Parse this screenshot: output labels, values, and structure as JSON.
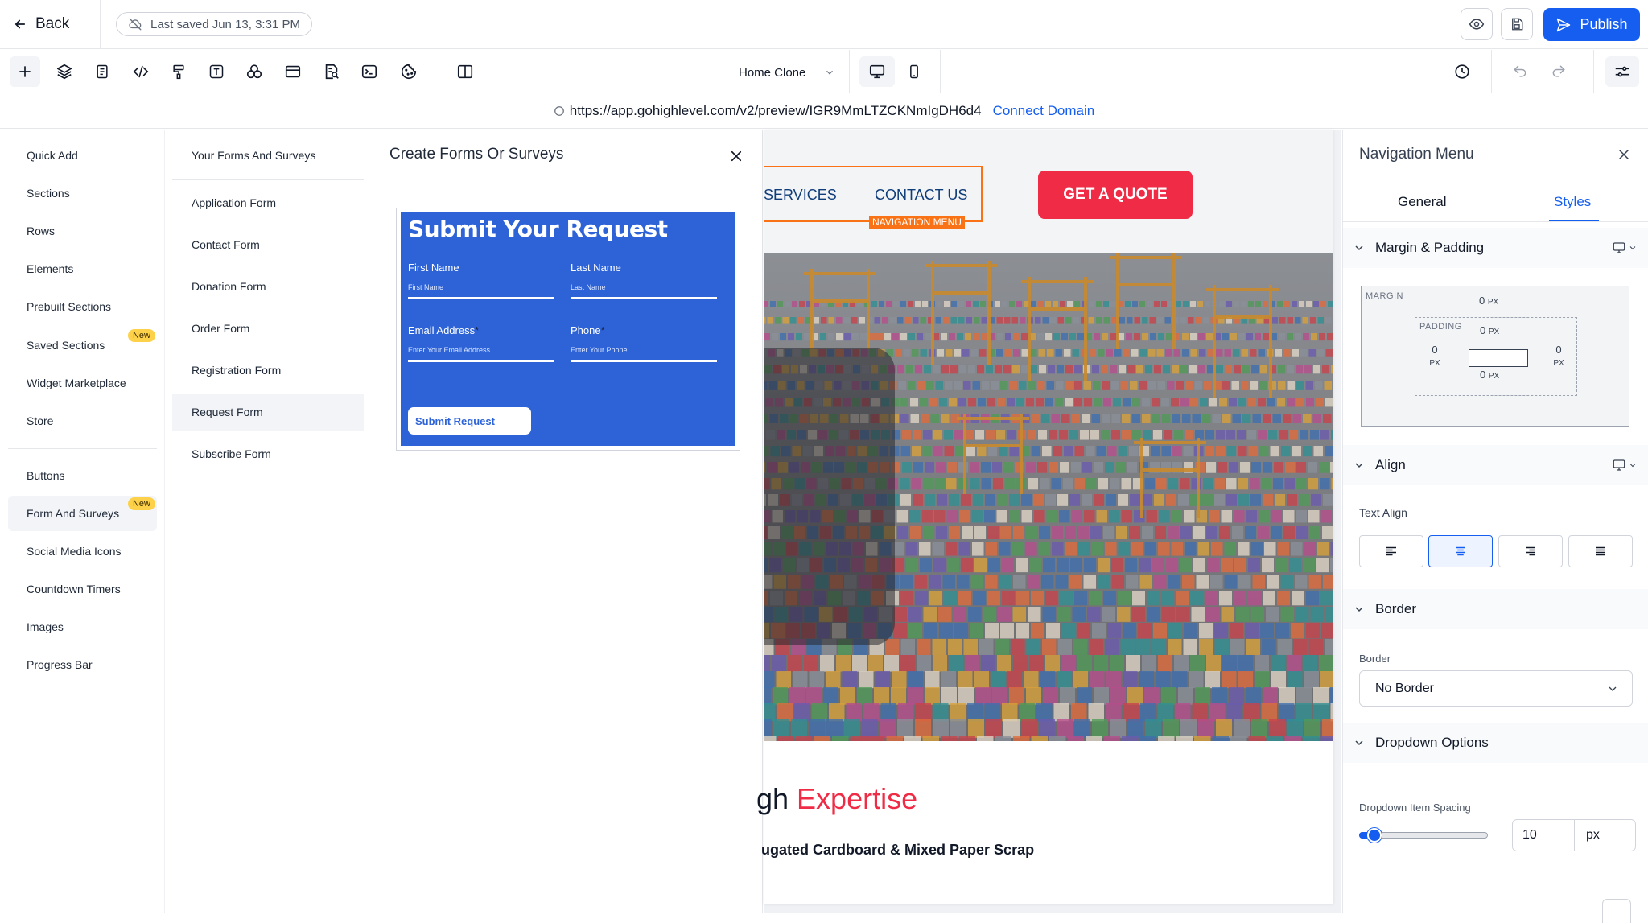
{
  "topbar": {
    "back_label": "Back",
    "last_saved": "Last saved Jun 13, 3:31 PM",
    "publish_label": "Publish"
  },
  "toolbar": {
    "page_name": "Home Clone",
    "icons": [
      "plus-icon",
      "layers-icon",
      "page-icon",
      "code-icon",
      "paint-icon",
      "text-icon",
      "apps-icon",
      "layout-icon",
      "search-page-icon",
      "terminal-icon",
      "cookie-icon",
      "columns-icon"
    ]
  },
  "urlbar": {
    "url": "https://app.gohighlevel.com/v2/preview/IGR9MmLTZCKNmIgDH6d4",
    "connect_label": "Connect Domain"
  },
  "left_menu": {
    "items": [
      {
        "label": "Quick Add"
      },
      {
        "label": "Sections"
      },
      {
        "label": "Rows"
      },
      {
        "label": "Elements"
      },
      {
        "label": "Prebuilt Sections"
      },
      {
        "label": "Saved Sections",
        "badge": "New"
      },
      {
        "label": "Widget Marketplace"
      },
      {
        "label": "Store"
      }
    ],
    "items2": [
      {
        "label": "Buttons"
      },
      {
        "label": "Form And Surveys",
        "badge": "New"
      },
      {
        "label": "Social Media Icons"
      },
      {
        "label": "Countdown Timers"
      },
      {
        "label": "Images"
      },
      {
        "label": "Progress Bar"
      }
    ]
  },
  "forms_list": {
    "header": "Your Forms And Surveys",
    "items": [
      "Application Form",
      "Contact Form",
      "Donation Form",
      "Order Form",
      "Registration Form",
      "Request Form",
      "Subscribe Form"
    ]
  },
  "create_panel": {
    "title": "Create Forms Or Surveys",
    "preview": {
      "title": "Submit Your Request",
      "first_name_label": "First Name",
      "first_name_placeholder": "First Name",
      "last_name_label": "Last Name",
      "last_name_placeholder": "Last Name",
      "email_label": "Email Address",
      "email_placeholder": "Enter Your Email Address",
      "phone_label": "Phone",
      "phone_placeholder": "Enter Your Phone",
      "required_mark": "*",
      "submit_label": "Submit Request"
    }
  },
  "canvas": {
    "nav_links": [
      "SERVICES",
      "CONTACT US"
    ],
    "nav_tag": "NAVIGATION MENU",
    "quote_button": "GET A QUOTE",
    "headline_part": "gh ",
    "headline_accent": "Expertise",
    "subline": "ugated Cardboard & Mixed Paper Scrap"
  },
  "right_panel": {
    "title": "Navigation Menu",
    "tabs": {
      "general": "General",
      "styles": "Styles"
    },
    "sections": {
      "margin_padding": "Margin & Padding",
      "align": "Align",
      "border": "Border",
      "dropdown": "Dropdown Options"
    },
    "margin_label": "MARGIN",
    "padding_label": "PADDING",
    "margin_top": "0",
    "padding_top": "0",
    "padding_left": "0",
    "padding_right": "0",
    "padding_bottom": "0",
    "unit": "PX",
    "text_align_label": "Text Align",
    "text_align_value": "center",
    "border_label": "Border",
    "border_value": "No Border",
    "dropdown_spacing_label": "Dropdown Item Spacing",
    "dropdown_spacing_value": "10",
    "dropdown_spacing_unit": "px"
  },
  "colors": {
    "accent": "#155eef",
    "quote": "#ef2b46",
    "nav_highlight": "#f97316",
    "form_bg": "#2d63d7",
    "badge": "#fdd24a"
  }
}
